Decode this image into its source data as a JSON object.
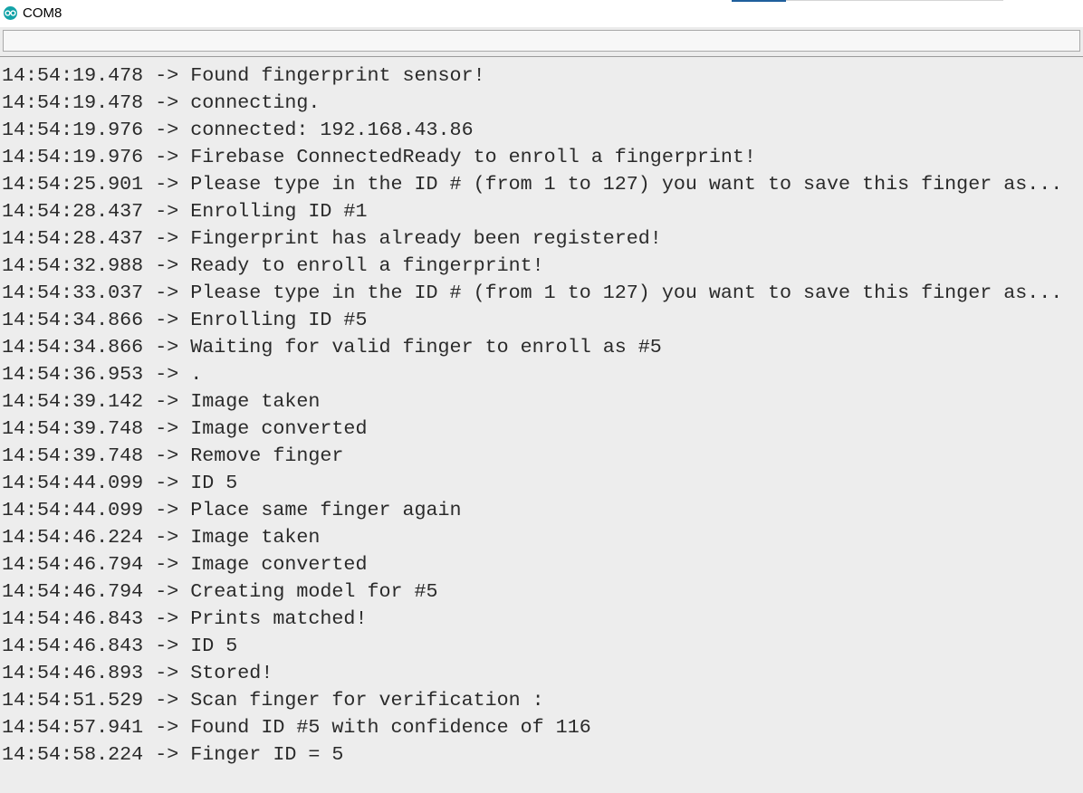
{
  "window": {
    "title": "COM8",
    "icon": "arduino-icon",
    "accent_color": "#14a3a8"
  },
  "input": {
    "value": "",
    "placeholder": ""
  },
  "log": [
    "14:54:19.478 -> Found fingerprint sensor!",
    "14:54:19.478 -> connecting.",
    "14:54:19.976 -> connected: 192.168.43.86",
    "14:54:19.976 -> Firebase ConnectedReady to enroll a fingerprint!",
    "14:54:25.901 -> Please type in the ID # (from 1 to 127) you want to save this finger as...",
    "14:54:28.437 -> Enrolling ID #1",
    "14:54:28.437 -> Fingerprint has already been registered!",
    "14:54:32.988 -> Ready to enroll a fingerprint!",
    "14:54:33.037 -> Please type in the ID # (from 1 to 127) you want to save this finger as...",
    "14:54:34.866 -> Enrolling ID #5",
    "14:54:34.866 -> Waiting for valid finger to enroll as #5",
    "14:54:36.953 -> .",
    "14:54:39.142 -> Image taken",
    "14:54:39.748 -> Image converted",
    "14:54:39.748 -> Remove finger",
    "14:54:44.099 -> ID 5",
    "14:54:44.099 -> Place same finger again",
    "14:54:46.224 -> Image taken",
    "14:54:46.794 -> Image converted",
    "14:54:46.794 -> Creating model for #5",
    "14:54:46.843 -> Prints matched!",
    "14:54:46.843 -> ID 5",
    "14:54:46.893 -> Stored!",
    "14:54:51.529 -> Scan finger for verification :",
    "14:54:57.941 -> Found ID #5 with confidence of 116",
    "14:54:58.224 -> Finger ID = 5"
  ]
}
